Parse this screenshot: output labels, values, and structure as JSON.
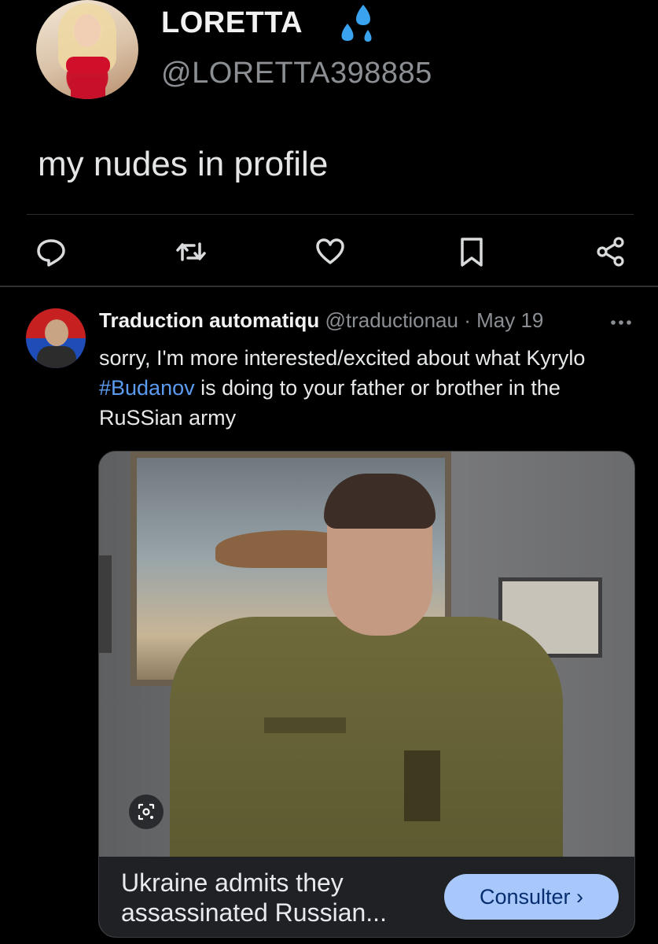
{
  "tweet1": {
    "name": "LORETTA",
    "handle": "@LORETTA398885",
    "text": "my nudes in profile",
    "badge_icon": "sweat-droplets-icon",
    "actions": [
      "reply-icon",
      "retweet-icon",
      "like-icon",
      "bookmark-icon",
      "share-icon"
    ]
  },
  "tweet2": {
    "name": "Traduction automatiqu",
    "handle": "@traductionau",
    "separator": "·",
    "date": "May 19",
    "text_before": "sorry, I'm more interested/excited about what Kyrylo ",
    "hashtag": "#Budanov",
    "text_after": " is doing to your father or brother in the RuSSian army",
    "card": {
      "title": "Ukraine admits they assassinated Russian...",
      "button": "Consulter ›"
    }
  },
  "colors": {
    "background": "#000000",
    "text": "#e7e9ea",
    "muted": "#8b8f94",
    "hashtag": "#5b9bf0",
    "button": "#a8c7fa",
    "drops": "#3aa3f0"
  }
}
